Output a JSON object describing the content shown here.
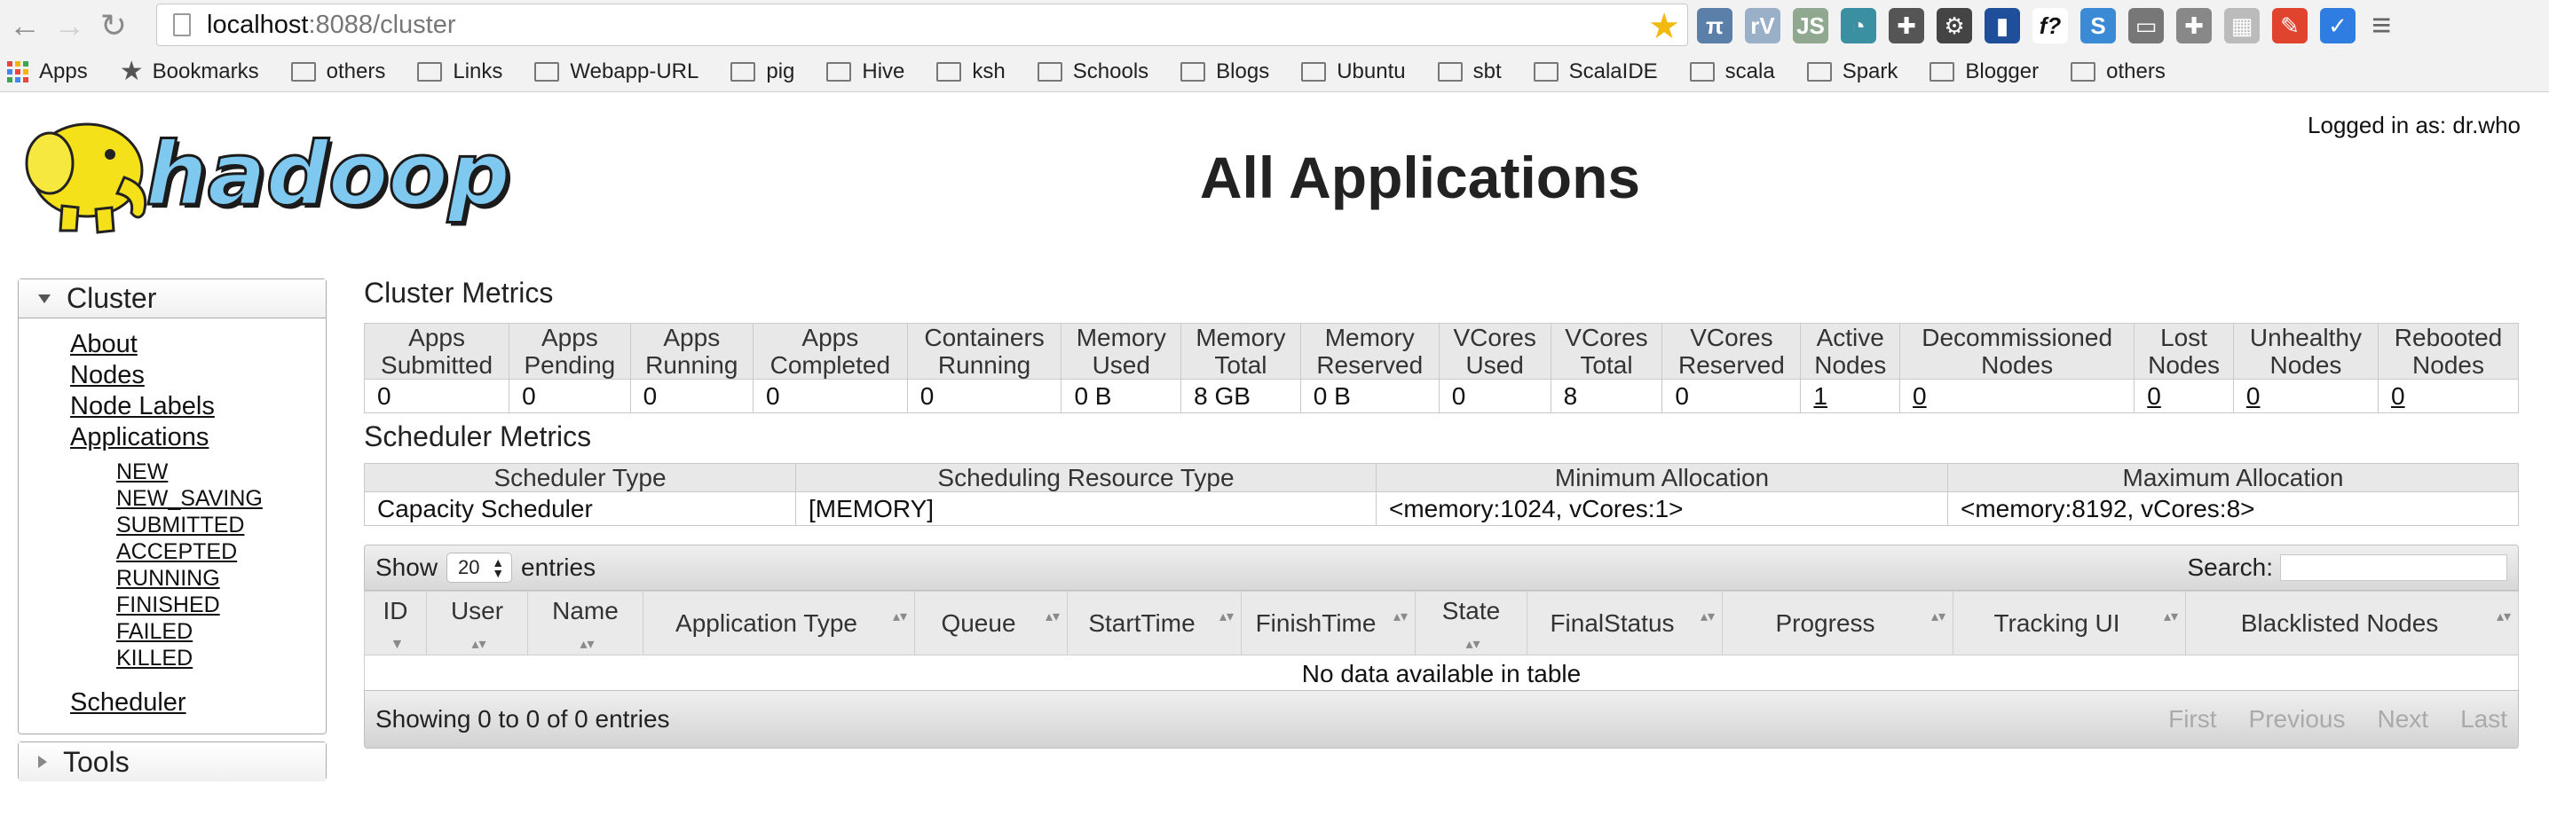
{
  "browser": {
    "url_host": "localhost",
    "url_path": ":8088/cluster",
    "bookmarks": [
      {
        "label": "Apps",
        "icon": "apps-grid-icon"
      },
      {
        "label": "Bookmarks",
        "icon": "star-icon"
      },
      {
        "label": "others",
        "icon": "folder-icon"
      },
      {
        "label": "Links",
        "icon": "folder-icon"
      },
      {
        "label": "Webapp-URL",
        "icon": "folder-icon"
      },
      {
        "label": "pig",
        "icon": "folder-icon"
      },
      {
        "label": "Hive",
        "icon": "folder-icon"
      },
      {
        "label": "ksh",
        "icon": "folder-icon"
      },
      {
        "label": "Schools",
        "icon": "folder-icon"
      },
      {
        "label": "Blogs",
        "icon": "folder-icon"
      },
      {
        "label": "Ubuntu",
        "icon": "folder-icon"
      },
      {
        "label": "sbt",
        "icon": "folder-icon"
      },
      {
        "label": "ScalaIDE",
        "icon": "folder-icon"
      },
      {
        "label": "scala",
        "icon": "folder-icon"
      },
      {
        "label": "Spark",
        "icon": "folder-icon"
      },
      {
        "label": "Blogger",
        "icon": "folder-icon"
      },
      {
        "label": "others",
        "icon": "folder-icon"
      }
    ],
    "extensions": [
      {
        "glyph": "π",
        "color": "#5a7fa8"
      },
      {
        "glyph": "rV",
        "color": "#9ab0c8"
      },
      {
        "glyph": "JS",
        "color": "#8fa88f"
      },
      {
        "glyph": "◔",
        "color": "#3a8fa0"
      },
      {
        "glyph": "✚",
        "color": "#555555"
      },
      {
        "glyph": "⚙",
        "color": "#444444"
      },
      {
        "glyph": "▮",
        "color": "#1f4f9a"
      },
      {
        "glyph": "f?",
        "color": "#ffffff"
      },
      {
        "glyph": "S",
        "color": "#3a8ad6"
      },
      {
        "glyph": "▭",
        "color": "#777777"
      },
      {
        "glyph": "✚",
        "color": "#888888"
      },
      {
        "glyph": "▦",
        "color": "#bbbbbb"
      },
      {
        "glyph": "✎",
        "color": "#e0442f"
      },
      {
        "glyph": "✓",
        "color": "#2f7de0"
      }
    ]
  },
  "header": {
    "logo_text": "hadoop",
    "title": "All Applications",
    "logged_in": "Logged in as: dr.who"
  },
  "sidebar": {
    "cluster_title": "Cluster",
    "links": [
      "About",
      "Nodes",
      "Node Labels",
      "Applications"
    ],
    "app_states": [
      "NEW",
      "NEW_SAVING",
      "SUBMITTED",
      "ACCEPTED",
      "RUNNING",
      "FINISHED",
      "FAILED",
      "KILLED"
    ],
    "scheduler_link": "Scheduler",
    "tools_title": "Tools"
  },
  "cluster_metrics": {
    "title": "Cluster Metrics",
    "columns": [
      {
        "label": [
          "Apps",
          "Submitted"
        ],
        "value": "0",
        "link": false
      },
      {
        "label": [
          "Apps",
          "Pending"
        ],
        "value": "0",
        "link": false
      },
      {
        "label": [
          "Apps",
          "Running"
        ],
        "value": "0",
        "link": false
      },
      {
        "label": [
          "Apps",
          "Completed"
        ],
        "value": "0",
        "link": false
      },
      {
        "label": [
          "Containers",
          "Running"
        ],
        "value": "0",
        "link": false
      },
      {
        "label": [
          "Memory",
          "Used"
        ],
        "value": "0 B",
        "link": false
      },
      {
        "label": [
          "Memory",
          "Total"
        ],
        "value": "8 GB",
        "link": false
      },
      {
        "label": [
          "Memory",
          "Reserved"
        ],
        "value": "0 B",
        "link": false
      },
      {
        "label": [
          "VCores",
          "Used"
        ],
        "value": "0",
        "link": false
      },
      {
        "label": [
          "VCores",
          "Total"
        ],
        "value": "8",
        "link": false
      },
      {
        "label": [
          "VCores",
          "Reserved"
        ],
        "value": "0",
        "link": false
      },
      {
        "label": [
          "Active",
          "Nodes"
        ],
        "value": "1",
        "link": true
      },
      {
        "label": [
          "Decommissioned",
          "Nodes"
        ],
        "value": "0",
        "link": true
      },
      {
        "label": [
          "Lost",
          "Nodes"
        ],
        "value": "0",
        "link": true
      },
      {
        "label": [
          "Unhealthy",
          "Nodes"
        ],
        "value": "0",
        "link": true
      },
      {
        "label": [
          "Rebooted",
          "Nodes"
        ],
        "value": "0",
        "link": true
      }
    ]
  },
  "scheduler_metrics": {
    "title": "Scheduler Metrics",
    "headers": [
      "Scheduler Type",
      "Scheduling Resource Type",
      "Minimum Allocation",
      "Maximum Allocation"
    ],
    "values": [
      "Capacity Scheduler",
      "[MEMORY]",
      "<memory:1024, vCores:1>",
      "<memory:8192, vCores:8>"
    ]
  },
  "apps_table": {
    "show_label": "Show",
    "entries_label": "entries",
    "page_size": "20",
    "search_label": "Search:",
    "columns": [
      "ID",
      "User",
      "Name",
      "Application Type",
      "Queue",
      "StartTime",
      "FinishTime",
      "State",
      "FinalStatus",
      "Progress",
      "Tracking UI",
      "Blacklisted Nodes"
    ],
    "empty_message": "No data available in table",
    "info": "Showing 0 to 0 of 0 entries",
    "pager": [
      "First",
      "Previous",
      "Next",
      "Last"
    ]
  }
}
